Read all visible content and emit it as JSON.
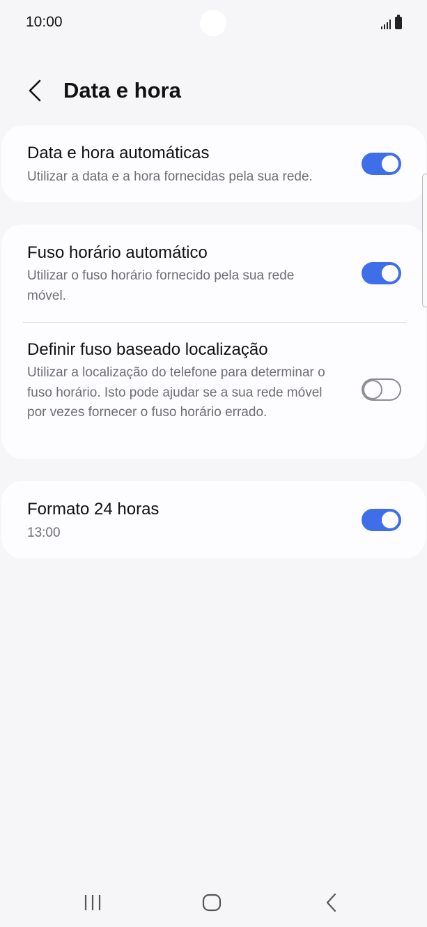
{
  "status_bar": {
    "time": "10:00",
    "icons": [
      "signal-icon",
      "battery-icon"
    ]
  },
  "header": {
    "back_icon": "chevron-left-icon",
    "title": "Data e hora"
  },
  "settings": [
    {
      "title": "Data e hora automáticas",
      "subtitle": "Utilizar a data e a hora fornecidas pela sua rede.",
      "toggle": "on"
    },
    {
      "title": "Fuso horário automático",
      "subtitle": "Utilizar o fuso horário fornecido pela sua rede móvel.",
      "toggle": "on"
    },
    {
      "title": "Definir fuso baseado localização",
      "subtitle": "Utilizar a localização do telefone para determinar o fuso horário. Isto pode ajudar se a sua rede móvel por vezes fornecer o fuso horário errado.",
      "toggle": "off"
    },
    {
      "title": "Formato 24 horas",
      "subtitle": "13:00",
      "toggle": "on"
    }
  ],
  "colors": {
    "toggle_on": "#3e6fe8",
    "toggle_off": "#8b8b92",
    "background": "#f6f6f8",
    "card": "#fdfdff"
  },
  "nav_bar": {
    "icons": [
      "recent-apps-icon",
      "home-icon",
      "back-icon"
    ]
  }
}
